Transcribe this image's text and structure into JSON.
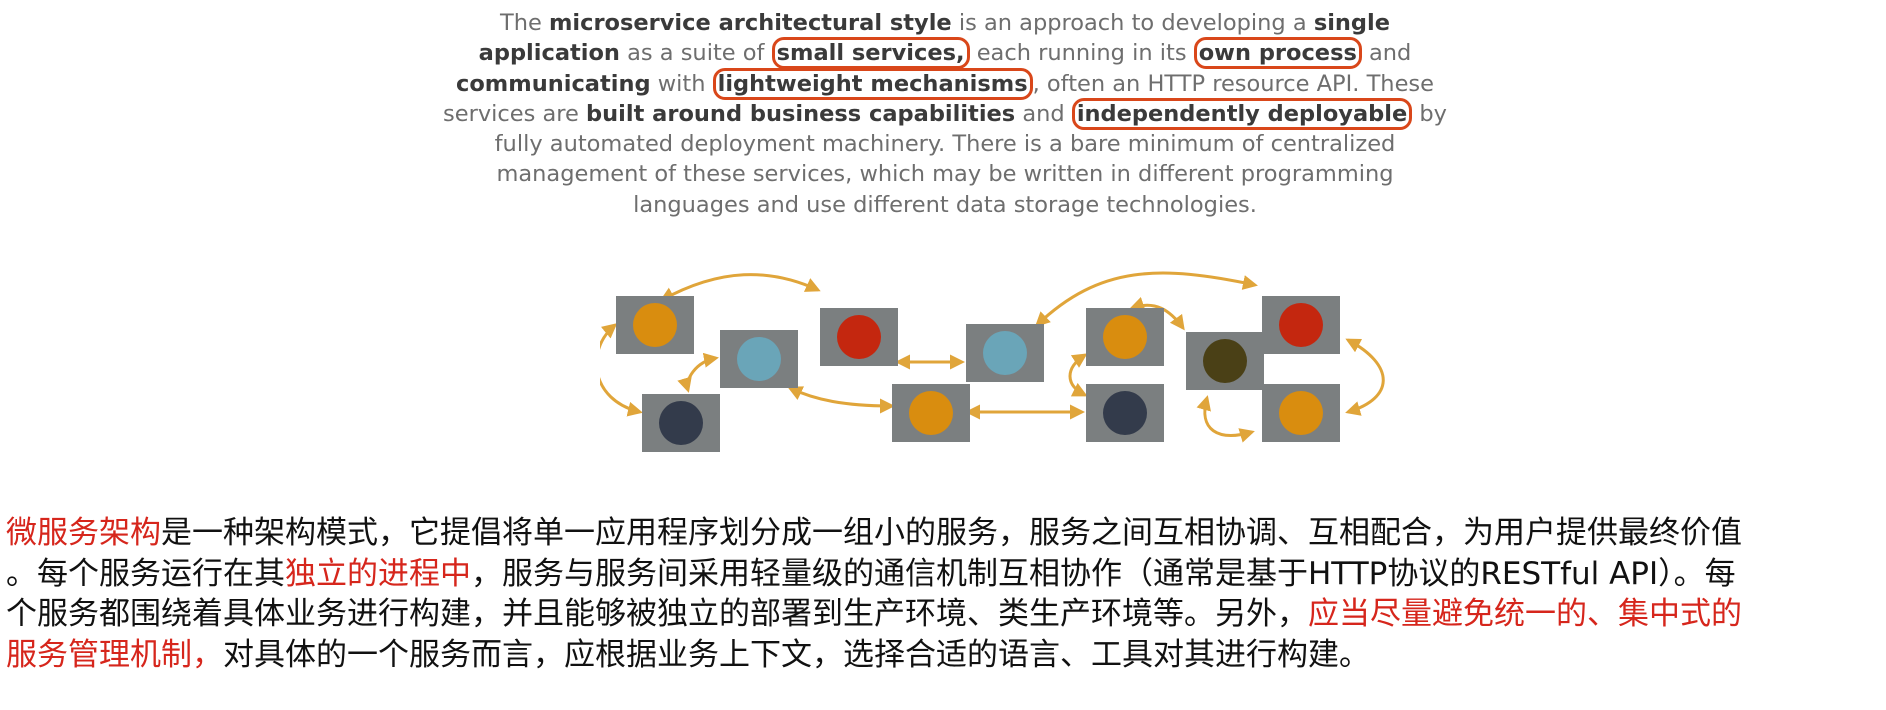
{
  "quote": {
    "lines": [
      [
        {
          "t": "The ",
          "s": "n"
        },
        {
          "t": "microservice architectural style",
          "s": "b"
        },
        {
          "t": " is an approach to developing a ",
          "s": "n"
        },
        {
          "t": "single",
          "s": "b"
        }
      ],
      [
        {
          "t": "application",
          "s": "b"
        },
        {
          "t": " as a suite of ",
          "s": "n"
        },
        {
          "t": "small services,",
          "s": "h"
        },
        {
          "t": " each running in its ",
          "s": "n"
        },
        {
          "t": "own process",
          "s": "h"
        },
        {
          "t": " and",
          "s": "n"
        }
      ],
      [
        {
          "t": "communicating",
          "s": "b"
        },
        {
          "t": " with ",
          "s": "n"
        },
        {
          "t": "lightweight mechanisms",
          "s": "h"
        },
        {
          "t": ", often an HTTP resource API. These",
          "s": "n"
        }
      ],
      [
        {
          "t": "services are ",
          "s": "n"
        },
        {
          "t": "built around business capabilities",
          "s": "b"
        },
        {
          "t": " and ",
          "s": "n"
        },
        {
          "t": "independently deployable",
          "s": "h"
        },
        {
          "t": " by",
          "s": "n"
        }
      ],
      [
        {
          "t": "fully automated deployment machinery. There is a bare minimum of centralized",
          "s": "n"
        }
      ],
      [
        {
          "t": "management of these services, which may be written in different programming",
          "s": "n"
        }
      ],
      [
        {
          "t": "languages and use different data storage technologies.",
          "s": "n"
        }
      ]
    ]
  },
  "colors": {
    "accent_red": "#d6261c",
    "highlight_border": "#d9471a",
    "box_gray": "#7b7f80",
    "link_gold": "#e0a53a"
  },
  "diagram": {
    "nodes": [
      {
        "name": "orange-node-1",
        "color": "#d98d0f"
      },
      {
        "name": "blue-node-1",
        "color": "#6aa5b8"
      },
      {
        "name": "navy-node-1",
        "color": "#333b4b"
      },
      {
        "name": "red-node-1",
        "color": "#c4270f"
      },
      {
        "name": "orange-node-2",
        "color": "#d98d0f"
      },
      {
        "name": "blue-node-2",
        "color": "#6aa5b8"
      },
      {
        "name": "orange-node-3",
        "color": "#d98d0f"
      },
      {
        "name": "navy-node-2",
        "color": "#333b4b"
      },
      {
        "name": "olive-node",
        "color": "#4a4016"
      },
      {
        "name": "red-node-2",
        "color": "#c4270f"
      },
      {
        "name": "orange-node-4",
        "color": "#d98d0f"
      }
    ]
  },
  "description": {
    "lines": [
      [
        {
          "t": "微服务架构",
          "s": "r"
        },
        {
          "t": "是一种架构模式，它提倡将单一应用程序划分成一组小的服务，服务之间互相协调、互相配合，为用户提供最终价值",
          "s": "n"
        }
      ],
      [
        {
          "t": "。每个服务运行在其",
          "s": "n"
        },
        {
          "t": "独立的进程中",
          "s": "r"
        },
        {
          "t": "，服务与服务间采用轻量级的通信机制互相协作（通常是基于HTTP协议的RESTful API）。每",
          "s": "n"
        }
      ],
      [
        {
          "t": "个服务都围绕着具体业务进行构建，并且能够被独立的部署到生产环境、类生产环境等。另外，",
          "s": "n"
        },
        {
          "t": "应当尽量避免统一的、集中式的",
          "s": "r"
        }
      ],
      [
        {
          "t": "服务管理机制，",
          "s": "r"
        },
        {
          "t": "对具体的一个服务而言，应根据业务上下文，选择合适的语言、工具对其进行构建。",
          "s": "n"
        }
      ]
    ]
  }
}
